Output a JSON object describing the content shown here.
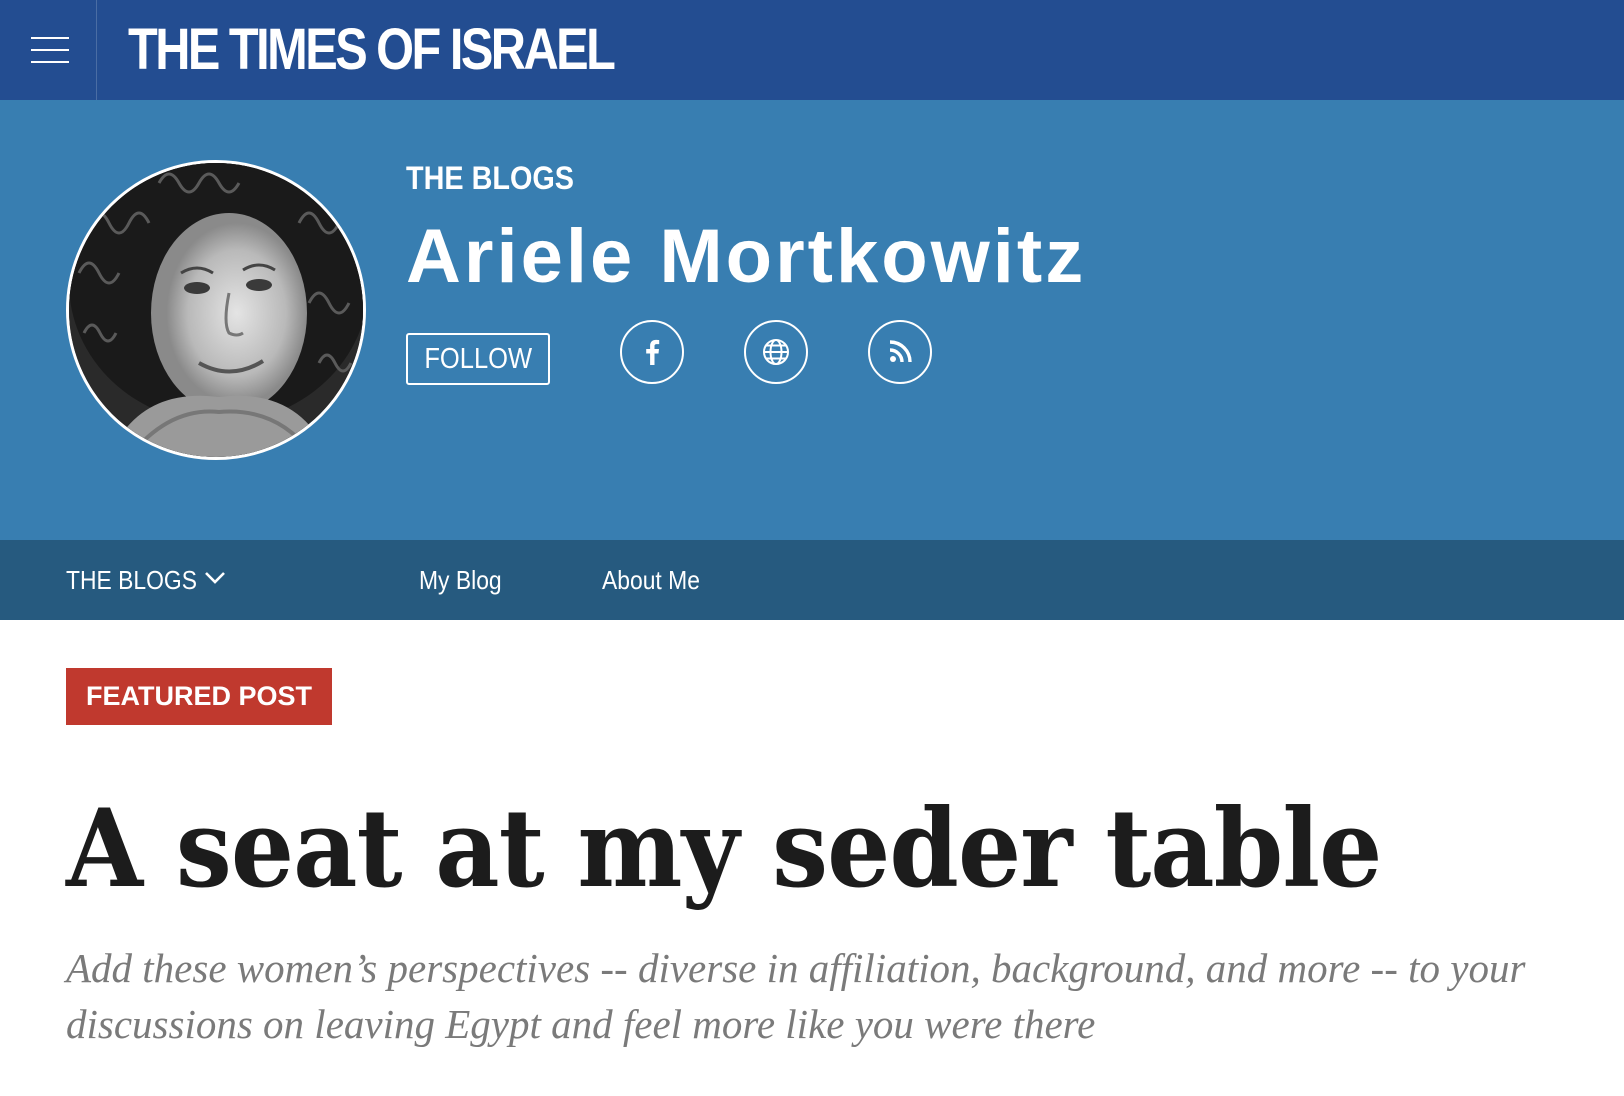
{
  "topbar": {
    "brand": "THE TIMES OF ISRAEL",
    "background_color": "#234d91"
  },
  "author_header": {
    "section_label": "THE BLOGS",
    "author_name": "Ariele Mortkowitz",
    "follow_label": "FOLLOW",
    "social_icons": [
      "facebook-icon",
      "globe-icon",
      "rss-icon"
    ],
    "background_color": "#387eb1"
  },
  "subnav": {
    "blogs_label": "THE BLOGS",
    "my_blog_label": "My Blog",
    "about_label": "About Me",
    "background_color": "#265a7f"
  },
  "article": {
    "badge": "FEATURED POST",
    "badge_color": "#c0392e",
    "title": "A seat at my seder table",
    "subtitle": "Add these women’s perspectives -- diverse in affiliation, background, and more -- to your discussions on leaving Egypt and feel more like you were there"
  }
}
